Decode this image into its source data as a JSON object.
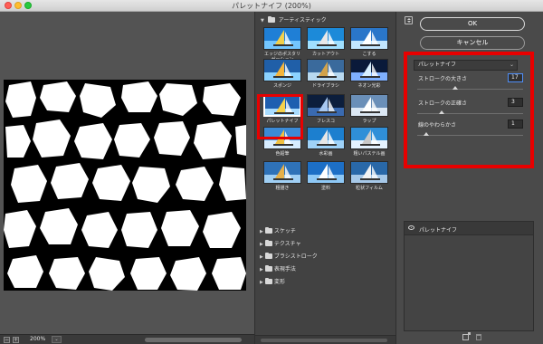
{
  "window": {
    "title": "パレットナイフ (200%)"
  },
  "preview": {
    "zoom_level": "200%",
    "zoom_out_label": "−",
    "zoom_in_label": "+",
    "zoom_dropdown": "⌄"
  },
  "gallery": {
    "category_title": "アーティスティック",
    "thumbnails": [
      {
        "label": "エッジのポスタリゼーション",
        "selected": false
      },
      {
        "label": "カットアウト",
        "selected": false
      },
      {
        "label": "こする",
        "selected": false
      },
      {
        "label": "スポンジ",
        "selected": false
      },
      {
        "label": "ドライブラシ",
        "selected": false
      },
      {
        "label": "ネオン光彩",
        "selected": false
      },
      {
        "label": "パレットナイフ",
        "selected": true
      },
      {
        "label": "フレスコ",
        "selected": false
      },
      {
        "label": "ラップ",
        "selected": false
      },
      {
        "label": "色鉛筆",
        "selected": false
      },
      {
        "label": "水彩画",
        "selected": false
      },
      {
        "label": "粗いパステル画",
        "selected": false
      },
      {
        "label": "粗描き",
        "selected": false
      },
      {
        "label": "塗料",
        "selected": false
      },
      {
        "label": "粒状フィルム",
        "selected": false
      }
    ],
    "categories": [
      {
        "label": "スケッチ"
      },
      {
        "label": "テクスチャ"
      },
      {
        "label": "ブラシストローク"
      },
      {
        "label": "表現手法"
      },
      {
        "label": "変形"
      }
    ]
  },
  "settings": {
    "ok_label": "OK",
    "cancel_label": "キャンセル",
    "filter_name": "パレットナイフ",
    "params": [
      {
        "label": "ストロークの大きさ",
        "value": "17",
        "fraction": 0.35
      },
      {
        "label": "ストロークの正確さ",
        "value": "3",
        "fraction": 0.22
      },
      {
        "label": "線のやわらかさ",
        "value": "1",
        "fraction": 0.08
      }
    ],
    "layer_name": "パレットナイフ"
  },
  "colors": {
    "highlight": "#e80000",
    "panel": "#535353",
    "dark_panel": "#424242",
    "accent": "#4f8ef7"
  },
  "icons": [
    "collapse-icon",
    "eye-icon",
    "new-layer-icon",
    "trash-icon",
    "folder-icon",
    "disclosure-triangle-icon",
    "chevron-down-icon"
  ]
}
